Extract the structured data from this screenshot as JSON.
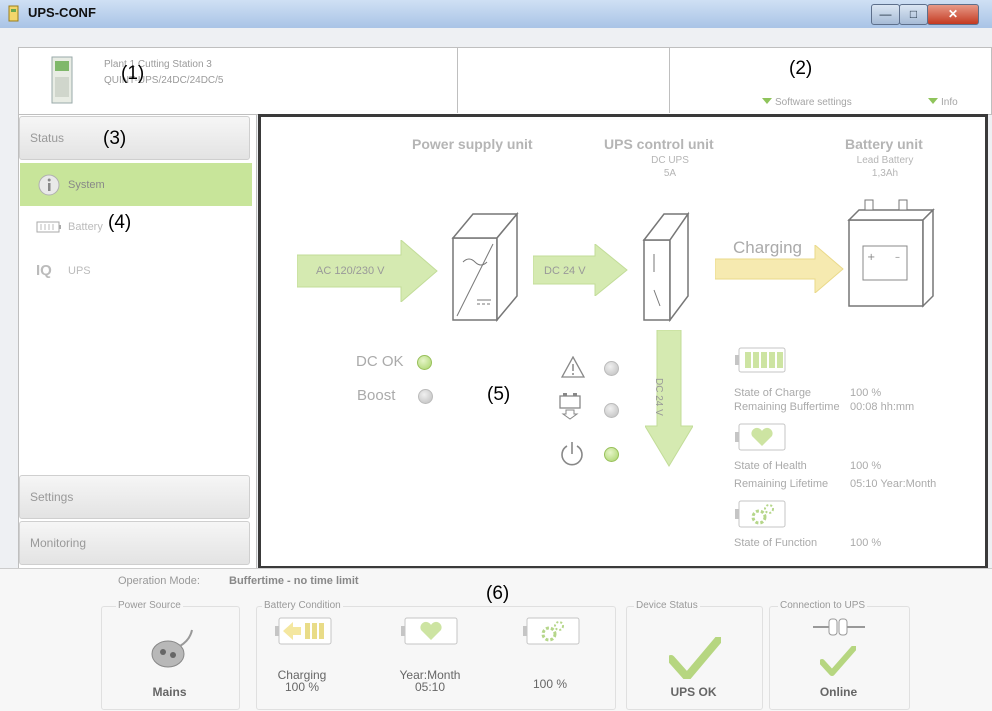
{
  "window": {
    "title": "UPS-CONF"
  },
  "header": {
    "device_name": "Plant 1 Cutting Station 3",
    "device_type": "QUINT-UPS/24DC/24DC/5",
    "software_settings": "Software settings",
    "info": "Info"
  },
  "callouts": {
    "c1": "(1)",
    "c2": "(2)",
    "c3": "(3)",
    "c4": "(4)",
    "c5": "(5)",
    "c6": "(6)"
  },
  "sidebar": {
    "status_label": "Status",
    "items": [
      {
        "label": "System",
        "icon": "info-icon",
        "selected": true
      },
      {
        "label": "Battery",
        "icon": "battery-icon",
        "selected": false
      },
      {
        "label": "UPS",
        "icon": "iq-icon",
        "selected": false
      }
    ],
    "settings_label": "Settings",
    "monitoring_label": "Monitoring"
  },
  "diagram": {
    "power_supply_title": "Power supply unit",
    "ups_control_title": "UPS control unit",
    "ups_control_sub1": "DC UPS",
    "ups_control_sub2": "5A",
    "battery_title": "Battery unit",
    "battery_sub1": "Lead Battery",
    "battery_sub2": "1,3Ah",
    "ac_input": "AC 120/230 V",
    "dc_link": "DC 24 V",
    "charging": "Charging",
    "dc_output": "DC 24 V",
    "dc_ok_label": "DC OK",
    "boost_label": "Boost",
    "state_of_charge_label": "State of Charge",
    "state_of_charge_value": "100 %",
    "remaining_buffertime_label": "Remaining Buffertime",
    "remaining_buffertime_value": "00:08 hh:mm",
    "state_of_health_label": "State of Health",
    "state_of_health_value": "100 %",
    "remaining_lifetime_label": "Remaining Lifetime",
    "remaining_lifetime_value": "05:10 Year:Month",
    "state_of_function_label": "State of Function",
    "state_of_function_value": "100 %"
  },
  "status_bar": {
    "operation_mode_label": "Operation Mode:",
    "operation_mode_value": "Buffertime - no time limit",
    "power_source_label": "Power Source",
    "power_source_value": "Mains",
    "battery_condition_label": "Battery Condition",
    "charging_value": "Charging",
    "charging_percent": "100 %",
    "lifetime_label": "Year:Month",
    "lifetime_value": "05:10",
    "function_percent": "100 %",
    "device_status_label": "Device Status",
    "device_status_value": "UPS OK",
    "connection_label": "Connection to UPS",
    "connection_value": "Online"
  },
  "colors": {
    "accent_green": "#8fc45b",
    "arrow_green": "#cfe6a7",
    "arrow_yellow": "#f5e7a3",
    "selection": "#c8e59a"
  }
}
